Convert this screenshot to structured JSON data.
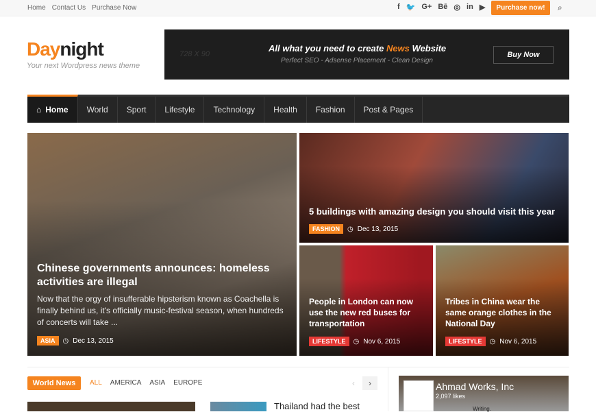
{
  "topbar": {
    "links": [
      "Home",
      "Contact Us",
      "Purchase Now"
    ],
    "social": [
      "f",
      "🐦",
      "G+",
      "Bē",
      "◎",
      "in",
      "▶"
    ],
    "purchase": "Purchase now!",
    "search_icon": "⌕"
  },
  "logo": {
    "day": "Day",
    "night": "night",
    "tagline": "Your next Wordpress news theme"
  },
  "banner": {
    "size": "728 X 90",
    "head_pre": "All what you need to create ",
    "head_accent": "News",
    "head_post": " Website",
    "sub": "Perfect SEO - Adsense Placement - Clean Design",
    "button": "Buy Now"
  },
  "nav": {
    "home_icon": "⌂",
    "items": [
      "Home",
      "World",
      "Sport",
      "Lifestyle",
      "Technology",
      "Health",
      "Fashion",
      "Post & Pages"
    ]
  },
  "hero": {
    "main": {
      "title": "Chinese governments announces: homeless activities are illegal",
      "excerpt": "Now that the orgy of insufferable hipsterism known as Coachella is finally behind us, it's officially music-festival season, when hundreds of concerts will take ...",
      "tag": "ASIA",
      "date": "Dec 13, 2015"
    },
    "top": {
      "title": "5 buildings with amazing design you should visit this year",
      "tag": "FASHION",
      "date": "Dec 13, 2015"
    },
    "left": {
      "title": "People in London can now use the new red buses for transportation",
      "tag": "LIFESTYLE",
      "date": "Nov 6, 2015"
    },
    "right": {
      "title": "Tribes in China wear the same orange clothes in the National Day",
      "tag": "LIFESTYLE",
      "date": "Nov 6, 2015"
    },
    "clock_icon": "◷"
  },
  "world_news": {
    "label": "World News",
    "filters": [
      "ALL",
      "AMERICA",
      "ASIA",
      "EUROPE"
    ],
    "prev": "‹",
    "next": "›",
    "article_title": "Thailand had the best"
  },
  "facebook": {
    "name": "Ahmad Works, Inc",
    "likes": "2,097 likes",
    "writing": "Writing."
  }
}
